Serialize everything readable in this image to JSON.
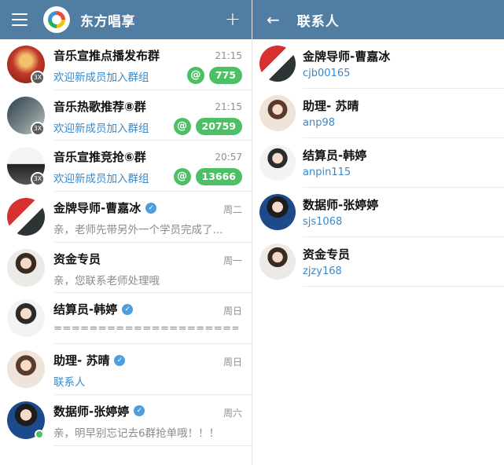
{
  "left_header": {
    "title": "东方唱享",
    "plus": "+"
  },
  "chats": [
    {
      "name": "音乐宣推点播发布群",
      "time": "21:15",
      "preview": "欢迎新成员加入群组",
      "preview_blue": true,
      "mention": "@",
      "count": "775",
      "verified": false,
      "avatar": "av-red",
      "mini_badge": "3X"
    },
    {
      "name": "音乐热歌推荐⑧群",
      "time": "21:15",
      "preview": "欢迎新成员加入群组",
      "preview_blue": true,
      "mention": "@",
      "count": "20759",
      "verified": false,
      "avatar": "av-dark",
      "mini_badge": "3X"
    },
    {
      "name": "音乐宣推竞抢⑥群",
      "time": "20:57",
      "preview": "欢迎新成员加入群组",
      "preview_blue": true,
      "mention": "@",
      "count": "13666",
      "verified": false,
      "avatar": "av-mono",
      "mini_badge": "3X"
    },
    {
      "name": "金牌导师-曹嘉冰",
      "time": "周二",
      "preview": "亲，老师先带另外一个学员完成了...",
      "preview_blue": false,
      "verified": true,
      "avatar": "av-poster"
    },
    {
      "name": "资金专员",
      "time": "周一",
      "preview": "亲，您联系老师处理哦",
      "preview_blue": false,
      "verified": false,
      "avatar": "av-woman2"
    },
    {
      "name": "结算员-韩婷",
      "time": "周日",
      "preview": "================================...",
      "preview_blue": false,
      "verified": true,
      "avatar": "av-woman"
    },
    {
      "name": "助理- 苏晴",
      "time": "周日",
      "preview": "联系人",
      "preview_blue": true,
      "verified": true,
      "avatar": "av-woman4"
    },
    {
      "name": "数据师-张婷婷",
      "time": "周六",
      "preview": "亲，明早别忘记去6群抢单哦！！！",
      "preview_blue": false,
      "verified": true,
      "avatar": "av-woman3",
      "online": true
    }
  ],
  "right_header": {
    "title": "联系人"
  },
  "contacts": [
    {
      "name": "金牌导师-曹嘉冰",
      "id": "cjb00165",
      "avatar": "av-poster"
    },
    {
      "name": "助理- 苏晴",
      "id": "anp98",
      "avatar": "av-woman4"
    },
    {
      "name": "结算员-韩婷",
      "id": "anpin115",
      "avatar": "av-woman"
    },
    {
      "name": "数据师-张婷婷",
      "id": "sjs1068",
      "avatar": "av-woman3"
    },
    {
      "name": "资金专员",
      "id": "zjzy168",
      "avatar": "av-woman2"
    }
  ],
  "colors": {
    "header": "#527da3",
    "badge": "#4cc064",
    "link": "#3a88c8",
    "verified": "#4d9edf"
  }
}
